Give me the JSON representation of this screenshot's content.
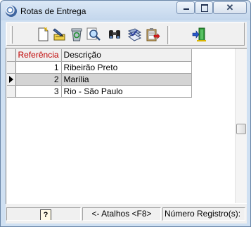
{
  "window": {
    "title": "Rotas de Entrega",
    "controls": {
      "close": "✕"
    }
  },
  "toolbar": {
    "buttons": [
      "new-icon",
      "edit-icon",
      "recycle-icon",
      "search-icon",
      "binoculars-icon",
      "document-check-icon",
      "clipboard-export-icon",
      "exit-door-icon"
    ]
  },
  "grid": {
    "columns": [
      "Referência",
      "Descrição"
    ],
    "rows": [
      {
        "ref": "1",
        "desc": "Ribeirão Preto"
      },
      {
        "ref": "2",
        "desc": "Marília"
      },
      {
        "ref": "3",
        "desc": "Rio - São Paulo"
      }
    ],
    "selected_index": 1
  },
  "statusbar": {
    "help": "?",
    "shortcuts": "<- Atalhos <F8>",
    "record_count": "Número Registro(s):"
  },
  "colors": {
    "header_accent": "#c00000",
    "selected_row": "#d4d4d4"
  }
}
